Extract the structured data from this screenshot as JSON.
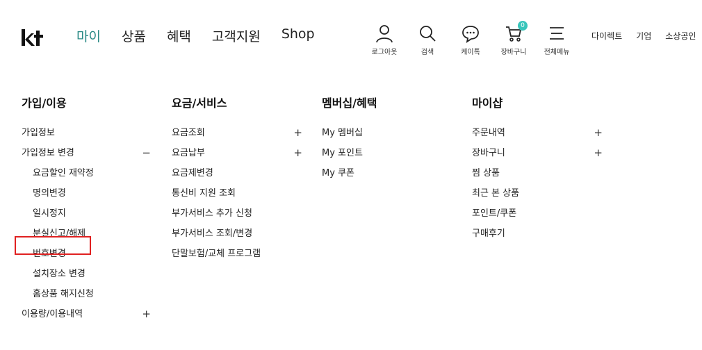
{
  "header": {
    "logo_text": "kt",
    "nav": [
      "마이",
      "상품",
      "혜택",
      "고객지원",
      "Shop"
    ],
    "utilities": [
      {
        "label": "로그아웃",
        "icon": "person-icon"
      },
      {
        "label": "검색",
        "icon": "search-icon"
      },
      {
        "label": "케이톡",
        "icon": "chat-icon"
      },
      {
        "label": "장바구니",
        "icon": "cart-icon",
        "badge": "0"
      },
      {
        "label": "전체메뉴",
        "icon": "menu-icon"
      }
    ],
    "links": [
      "다이렉트",
      "기업",
      "소상공인"
    ]
  },
  "menu": {
    "col1": {
      "title": "가입/이용",
      "items": [
        "가입정보",
        "가입정보 변경",
        "요금할인 재약정",
        "명의변경",
        "일시정지",
        "분실신고/해제",
        "번호변경",
        "설치장소 변경",
        "홈상품 해지신청",
        "이용량/이용내역"
      ],
      "toggles": {
        "collapse": "−",
        "expand": "+"
      }
    },
    "col2": {
      "title": "요금/서비스",
      "items": [
        "요금조회",
        "요금납부",
        "요금제변경",
        "통신비 지원 조회",
        "부가서비스 추가 신청",
        "부가서비스 조회/변경",
        "단말보험/교체 프로그램"
      ],
      "toggle": "+"
    },
    "col3": {
      "title": "멤버십/혜택",
      "items": [
        "My 멤버십",
        "My 포인트",
        "My 쿠폰"
      ]
    },
    "col4": {
      "title": "마이샵",
      "items": [
        "주문내역",
        "장바구니",
        "찜 상품",
        "최근 본 상품",
        "포인트/쿠폰",
        "구매후기"
      ],
      "toggle": "+"
    }
  },
  "colors": {
    "accent": "#2a8a85",
    "badge": "#39c5bb",
    "highlight": "#e02020"
  }
}
